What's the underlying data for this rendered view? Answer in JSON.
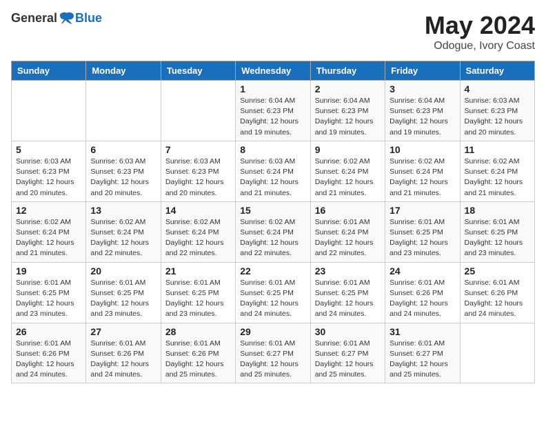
{
  "header": {
    "logo_general": "General",
    "logo_blue": "Blue",
    "month": "May 2024",
    "location": "Odogue, Ivory Coast"
  },
  "days_of_week": [
    "Sunday",
    "Monday",
    "Tuesday",
    "Wednesday",
    "Thursday",
    "Friday",
    "Saturday"
  ],
  "weeks": [
    [
      {
        "day": "",
        "info": ""
      },
      {
        "day": "",
        "info": ""
      },
      {
        "day": "",
        "info": ""
      },
      {
        "day": "1",
        "info": "Sunrise: 6:04 AM\nSunset: 6:23 PM\nDaylight: 12 hours\nand 19 minutes."
      },
      {
        "day": "2",
        "info": "Sunrise: 6:04 AM\nSunset: 6:23 PM\nDaylight: 12 hours\nand 19 minutes."
      },
      {
        "day": "3",
        "info": "Sunrise: 6:04 AM\nSunset: 6:23 PM\nDaylight: 12 hours\nand 19 minutes."
      },
      {
        "day": "4",
        "info": "Sunrise: 6:03 AM\nSunset: 6:23 PM\nDaylight: 12 hours\nand 20 minutes."
      }
    ],
    [
      {
        "day": "5",
        "info": "Sunrise: 6:03 AM\nSunset: 6:23 PM\nDaylight: 12 hours\nand 20 minutes."
      },
      {
        "day": "6",
        "info": "Sunrise: 6:03 AM\nSunset: 6:23 PM\nDaylight: 12 hours\nand 20 minutes."
      },
      {
        "day": "7",
        "info": "Sunrise: 6:03 AM\nSunset: 6:23 PM\nDaylight: 12 hours\nand 20 minutes."
      },
      {
        "day": "8",
        "info": "Sunrise: 6:03 AM\nSunset: 6:24 PM\nDaylight: 12 hours\nand 21 minutes."
      },
      {
        "day": "9",
        "info": "Sunrise: 6:02 AM\nSunset: 6:24 PM\nDaylight: 12 hours\nand 21 minutes."
      },
      {
        "day": "10",
        "info": "Sunrise: 6:02 AM\nSunset: 6:24 PM\nDaylight: 12 hours\nand 21 minutes."
      },
      {
        "day": "11",
        "info": "Sunrise: 6:02 AM\nSunset: 6:24 PM\nDaylight: 12 hours\nand 21 minutes."
      }
    ],
    [
      {
        "day": "12",
        "info": "Sunrise: 6:02 AM\nSunset: 6:24 PM\nDaylight: 12 hours\nand 21 minutes."
      },
      {
        "day": "13",
        "info": "Sunrise: 6:02 AM\nSunset: 6:24 PM\nDaylight: 12 hours\nand 22 minutes."
      },
      {
        "day": "14",
        "info": "Sunrise: 6:02 AM\nSunset: 6:24 PM\nDaylight: 12 hours\nand 22 minutes."
      },
      {
        "day": "15",
        "info": "Sunrise: 6:02 AM\nSunset: 6:24 PM\nDaylight: 12 hours\nand 22 minutes."
      },
      {
        "day": "16",
        "info": "Sunrise: 6:01 AM\nSunset: 6:24 PM\nDaylight: 12 hours\nand 22 minutes."
      },
      {
        "day": "17",
        "info": "Sunrise: 6:01 AM\nSunset: 6:25 PM\nDaylight: 12 hours\nand 23 minutes."
      },
      {
        "day": "18",
        "info": "Sunrise: 6:01 AM\nSunset: 6:25 PM\nDaylight: 12 hours\nand 23 minutes."
      }
    ],
    [
      {
        "day": "19",
        "info": "Sunrise: 6:01 AM\nSunset: 6:25 PM\nDaylight: 12 hours\nand 23 minutes."
      },
      {
        "day": "20",
        "info": "Sunrise: 6:01 AM\nSunset: 6:25 PM\nDaylight: 12 hours\nand 23 minutes."
      },
      {
        "day": "21",
        "info": "Sunrise: 6:01 AM\nSunset: 6:25 PM\nDaylight: 12 hours\nand 23 minutes."
      },
      {
        "day": "22",
        "info": "Sunrise: 6:01 AM\nSunset: 6:25 PM\nDaylight: 12 hours\nand 24 minutes."
      },
      {
        "day": "23",
        "info": "Sunrise: 6:01 AM\nSunset: 6:25 PM\nDaylight: 12 hours\nand 24 minutes."
      },
      {
        "day": "24",
        "info": "Sunrise: 6:01 AM\nSunset: 6:26 PM\nDaylight: 12 hours\nand 24 minutes."
      },
      {
        "day": "25",
        "info": "Sunrise: 6:01 AM\nSunset: 6:26 PM\nDaylight: 12 hours\nand 24 minutes."
      }
    ],
    [
      {
        "day": "26",
        "info": "Sunrise: 6:01 AM\nSunset: 6:26 PM\nDaylight: 12 hours\nand 24 minutes."
      },
      {
        "day": "27",
        "info": "Sunrise: 6:01 AM\nSunset: 6:26 PM\nDaylight: 12 hours\nand 24 minutes."
      },
      {
        "day": "28",
        "info": "Sunrise: 6:01 AM\nSunset: 6:26 PM\nDaylight: 12 hours\nand 25 minutes."
      },
      {
        "day": "29",
        "info": "Sunrise: 6:01 AM\nSunset: 6:27 PM\nDaylight: 12 hours\nand 25 minutes."
      },
      {
        "day": "30",
        "info": "Sunrise: 6:01 AM\nSunset: 6:27 PM\nDaylight: 12 hours\nand 25 minutes."
      },
      {
        "day": "31",
        "info": "Sunrise: 6:01 AM\nSunset: 6:27 PM\nDaylight: 12 hours\nand 25 minutes."
      },
      {
        "day": "",
        "info": ""
      }
    ]
  ]
}
